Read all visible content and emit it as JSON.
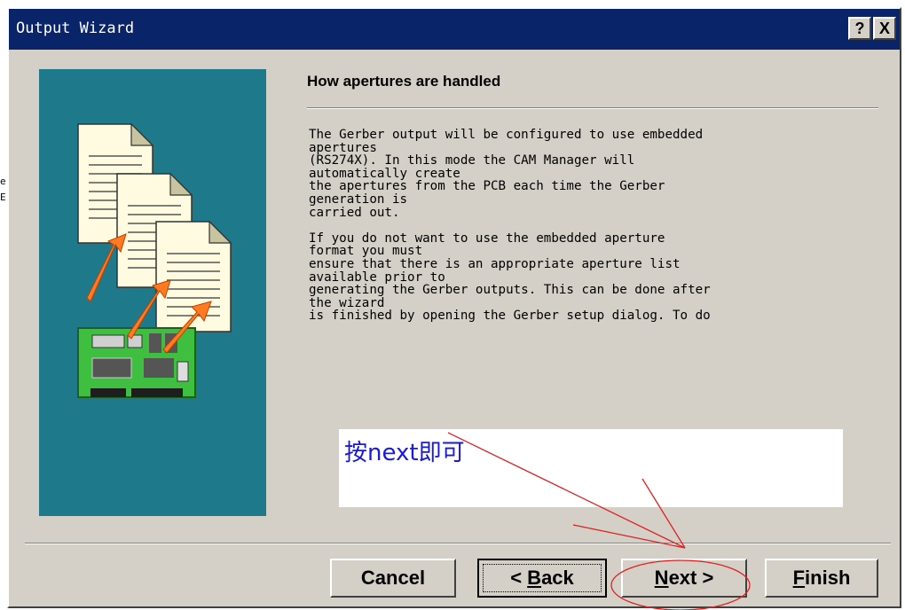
{
  "window": {
    "title": "Output Wizard",
    "help_label": "?",
    "close_label": "X"
  },
  "page": {
    "heading": "How apertures are handled",
    "description_lines": [
      "The Gerber output will be configured to use embedded",
      "apertures",
      "(RS274X). In this mode the CAM Manager will",
      "automatically create",
      "the apertures from the PCB each time the Gerber",
      "generation is",
      "carried out.",
      "",
      "If you do not want to use the embedded aperture",
      "format you must",
      "ensure that there is an appropriate aperture list",
      "available prior to",
      "generating the Gerber outputs. This can be done after",
      "the wizard",
      "is finished by opening the Gerber setup dialog. To do"
    ]
  },
  "annotation": {
    "note": "按next即可",
    "color": "#e02020"
  },
  "buttons": {
    "cancel": "Cancel",
    "back": "< Back",
    "next": "Next >",
    "finish": "Finish"
  },
  "colors": {
    "titlebar": "#0a246a",
    "dialog": "#d4d0c8",
    "art_background": "#1e7a8a",
    "note_text": "#1818e0"
  },
  "icons": [
    "document-stack-icon",
    "circuit-board-icon",
    "help-icon",
    "close-icon"
  ]
}
